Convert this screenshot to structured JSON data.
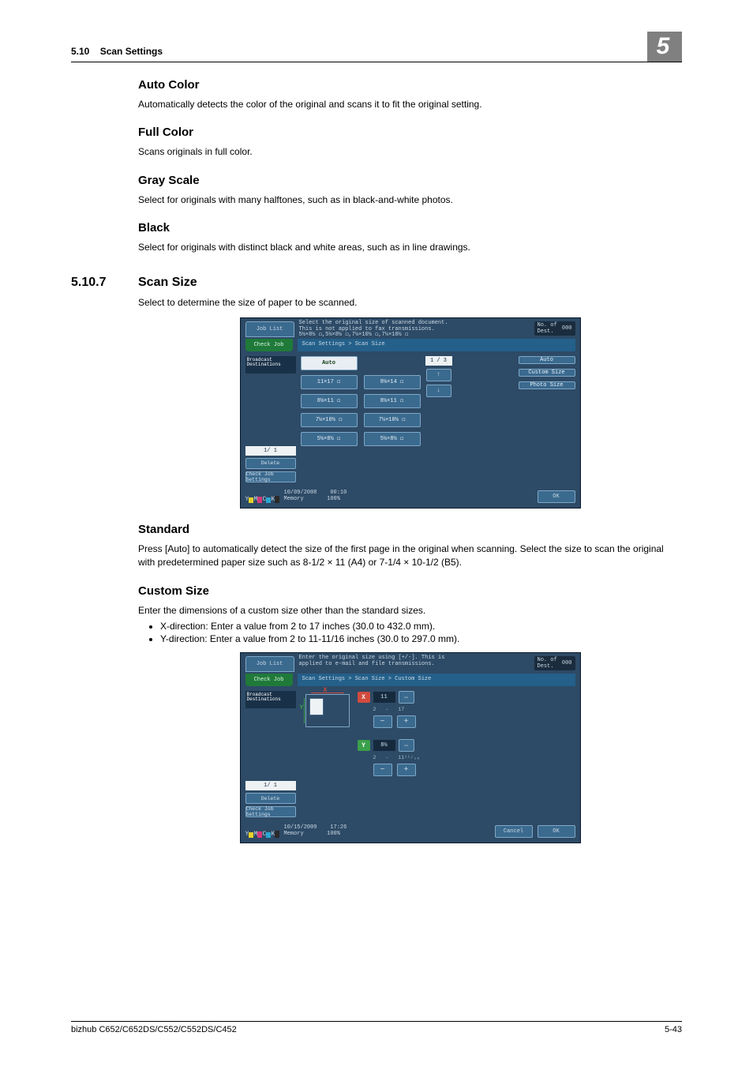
{
  "header": {
    "section_no": "5.10",
    "section_title": "Scan Settings",
    "chapter_badge": "5"
  },
  "sections": {
    "auto_color": {
      "title": "Auto Color",
      "body": "Automatically detects the color of the original and scans it to fit the original setting."
    },
    "full_color": {
      "title": "Full Color",
      "body": "Scans originals in full color."
    },
    "gray_scale": {
      "title": "Gray Scale",
      "body": "Select for originals with many halftones, such as in black-and-white photos."
    },
    "black": {
      "title": "Black",
      "body": "Select for originals with distinct black and white areas, such as in line drawings."
    },
    "scan_size": {
      "number": "5.10.7",
      "title": "Scan Size",
      "body": "Select to determine the size of paper to be scanned."
    },
    "standard": {
      "title": "Standard",
      "body": "Press [Auto] to automatically detect the size of the first page in the original when scanning. Select the size to scan the original with predetermined paper size such as 8-1/2 × 11 (A4) or 7-1/4 × 10-1/2 (B5)."
    },
    "custom_size": {
      "title": "Custom Size",
      "body": "Enter the dimensions of a custom size other than the standard sizes.",
      "bullets": [
        "X-direction: Enter a value from 2 to 17 inches (30.0 to 432.0 mm).",
        "Y-direction: Enter a value from 2 to 11-11/16 inches (30.0 to 297.0 mm)."
      ]
    }
  },
  "screenshot1": {
    "job_list": "Job List",
    "top_msg_line1": "Select the original size of scanned document.",
    "top_msg_line2": "This is not applied to fax transmissions.",
    "top_msg_line3": "5½×8½ ◻,5½×8½ ◻,7¼×10½ ◻,7¼×10½ ◻",
    "dest_label": "No. of Dest.",
    "dest_count": "000",
    "check_job": "Check Job",
    "breadcrumb": "Scan Settings > Scan Size",
    "broadcast": "Broadcast Destinations",
    "page_of": "1/  1",
    "delete": "Delete",
    "check_job_settings": "Check Job Settings",
    "sizes_col1": [
      "Auto",
      "11×17 ◻",
      "8½×11 ◻",
      "7¼×10½ ◻",
      "5½×8½ ◻"
    ],
    "sizes_col2": [
      "",
      "8½×14 ◻",
      "8½×11 ◻",
      "7¼×10½ ◻",
      "5½×8½ ◻"
    ],
    "pager": {
      "display": "1 / 3",
      "up": "↑",
      "down": "↓"
    },
    "right_tabs": [
      "Auto",
      "Custom Size",
      "Photo Size"
    ],
    "footer": {
      "date": "10/09/2008",
      "time": "00:10",
      "memory": "Memory",
      "mem_pct": "100%",
      "ok": "OK"
    },
    "toner": {
      "Y": "#e7d12a",
      "M": "#d23a7a",
      "C": "#2aa7d1",
      "K": "#2a2a2a"
    }
  },
  "screenshot2": {
    "job_list": "Job List",
    "top_msg_line1": "Enter the original size using [+/-]. This is",
    "top_msg_line2": "applied to e-mail and file transmissions.",
    "dest_label": "No. of Dest.",
    "dest_count": "000",
    "check_job": "Check Job",
    "breadcrumb": "Scan Settings > Scan Size > Custom Size",
    "broadcast": "Broadcast Destinations",
    "page_of": "1/  1",
    "delete": "Delete",
    "check_job_settings": "Check Job Settings",
    "x_label": "X",
    "y_label": "Y",
    "x_value": "11",
    "x_min": "2",
    "x_max": "17",
    "y_value": "8½",
    "y_min": "2",
    "y_max": "11¹¹⁄₁₆",
    "swap": "⇔",
    "minus": "−",
    "plus": "+",
    "footer": {
      "date": "10/15/2009",
      "time": "17:26",
      "memory": "Memory",
      "mem_pct": "100%",
      "cancel": "Cancel",
      "ok": "OK"
    }
  },
  "footer": {
    "model": "bizhub C652/C652DS/C552/C552DS/C452",
    "page": "5-43"
  }
}
